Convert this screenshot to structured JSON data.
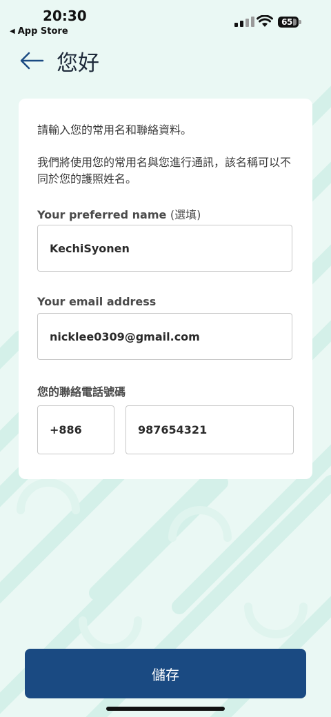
{
  "status_bar": {
    "time": "20:30",
    "back_label": "App Store",
    "battery": "65"
  },
  "header": {
    "title": "您好"
  },
  "form": {
    "intro_line1": "請輸入您的常用名和聯絡資料。",
    "intro_line2": "我們將使用您的常用名與您進行通訊，該名稱可以不同於您的護照姓名。",
    "name": {
      "label": "Your preferred name",
      "optional": "(選填)",
      "value": "KechiSyonen"
    },
    "email": {
      "label": "Your email address",
      "value": "nicklee0309@gmail.com"
    },
    "phone": {
      "label": "您的聯絡電話號碼",
      "country_code": "+886",
      "number": "987654321"
    }
  },
  "actions": {
    "save_label": "儲存"
  },
  "colors": {
    "background": "#eaf8f4",
    "pattern": "#d6f1ea",
    "primary_button": "#1a4a82",
    "back_arrow": "#1a4a82"
  }
}
